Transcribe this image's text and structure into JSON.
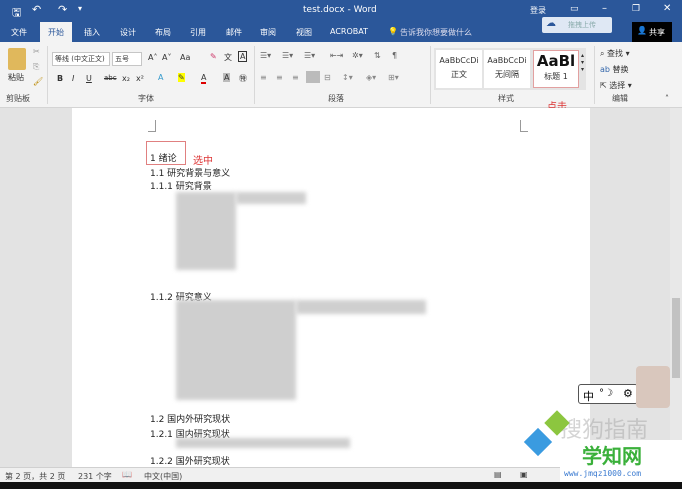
{
  "titlebar": {
    "title": "test.docx - Word",
    "login": "登录",
    "controls": [
      "minimize",
      "restore",
      "close"
    ]
  },
  "tabs": [
    "文件",
    "开始",
    "插入",
    "设计",
    "布局",
    "引用",
    "邮件",
    "审阅",
    "视图",
    "ACROBAT"
  ],
  "tell_me": "告诉我你想要做什么",
  "upload": "拖拽上传",
  "share": "共享",
  "ribbon": {
    "clipboard": {
      "paste": "粘贴",
      "label": "剪贴板"
    },
    "font": {
      "name": "等线 (中文正文)",
      "size": "五号",
      "label": "字体",
      "aa": "Aa",
      "bold": "B",
      "italic": "I",
      "underline": "U",
      "strike": "abc",
      "sub": "x₂",
      "sup": "x²"
    },
    "paragraph": {
      "label": "段落"
    },
    "styles": {
      "items": [
        {
          "preview": "AaBbCcDi",
          "name": "正文"
        },
        {
          "preview": "AaBbCcDi",
          "name": "无间隔"
        },
        {
          "preview": "AaBl",
          "name": "标题 1"
        }
      ],
      "label": "样式"
    },
    "editing": {
      "find": "查找",
      "replace": "替换",
      "select": "选择",
      "label": "编辑"
    }
  },
  "annotations": {
    "selected": "选中",
    "click": "点击"
  },
  "document": {
    "lines": [
      "1 绪论",
      "1.1 研究背景与意义",
      "1.1.1 研究背景",
      "1.1.2 研究意义",
      "1.2 国内外研究现状",
      "1.2.1 国内研究现状",
      "1.2.2 国外研究现状"
    ]
  },
  "ime": {
    "lang": "中"
  },
  "watermarks": {
    "sogou": "搜狗指南",
    "site": "学知网",
    "url": "www.jmqz1000.com"
  },
  "status": {
    "page": "第 2 页，共 2 页",
    "words": "231 个字",
    "language": "中文(中国)"
  }
}
